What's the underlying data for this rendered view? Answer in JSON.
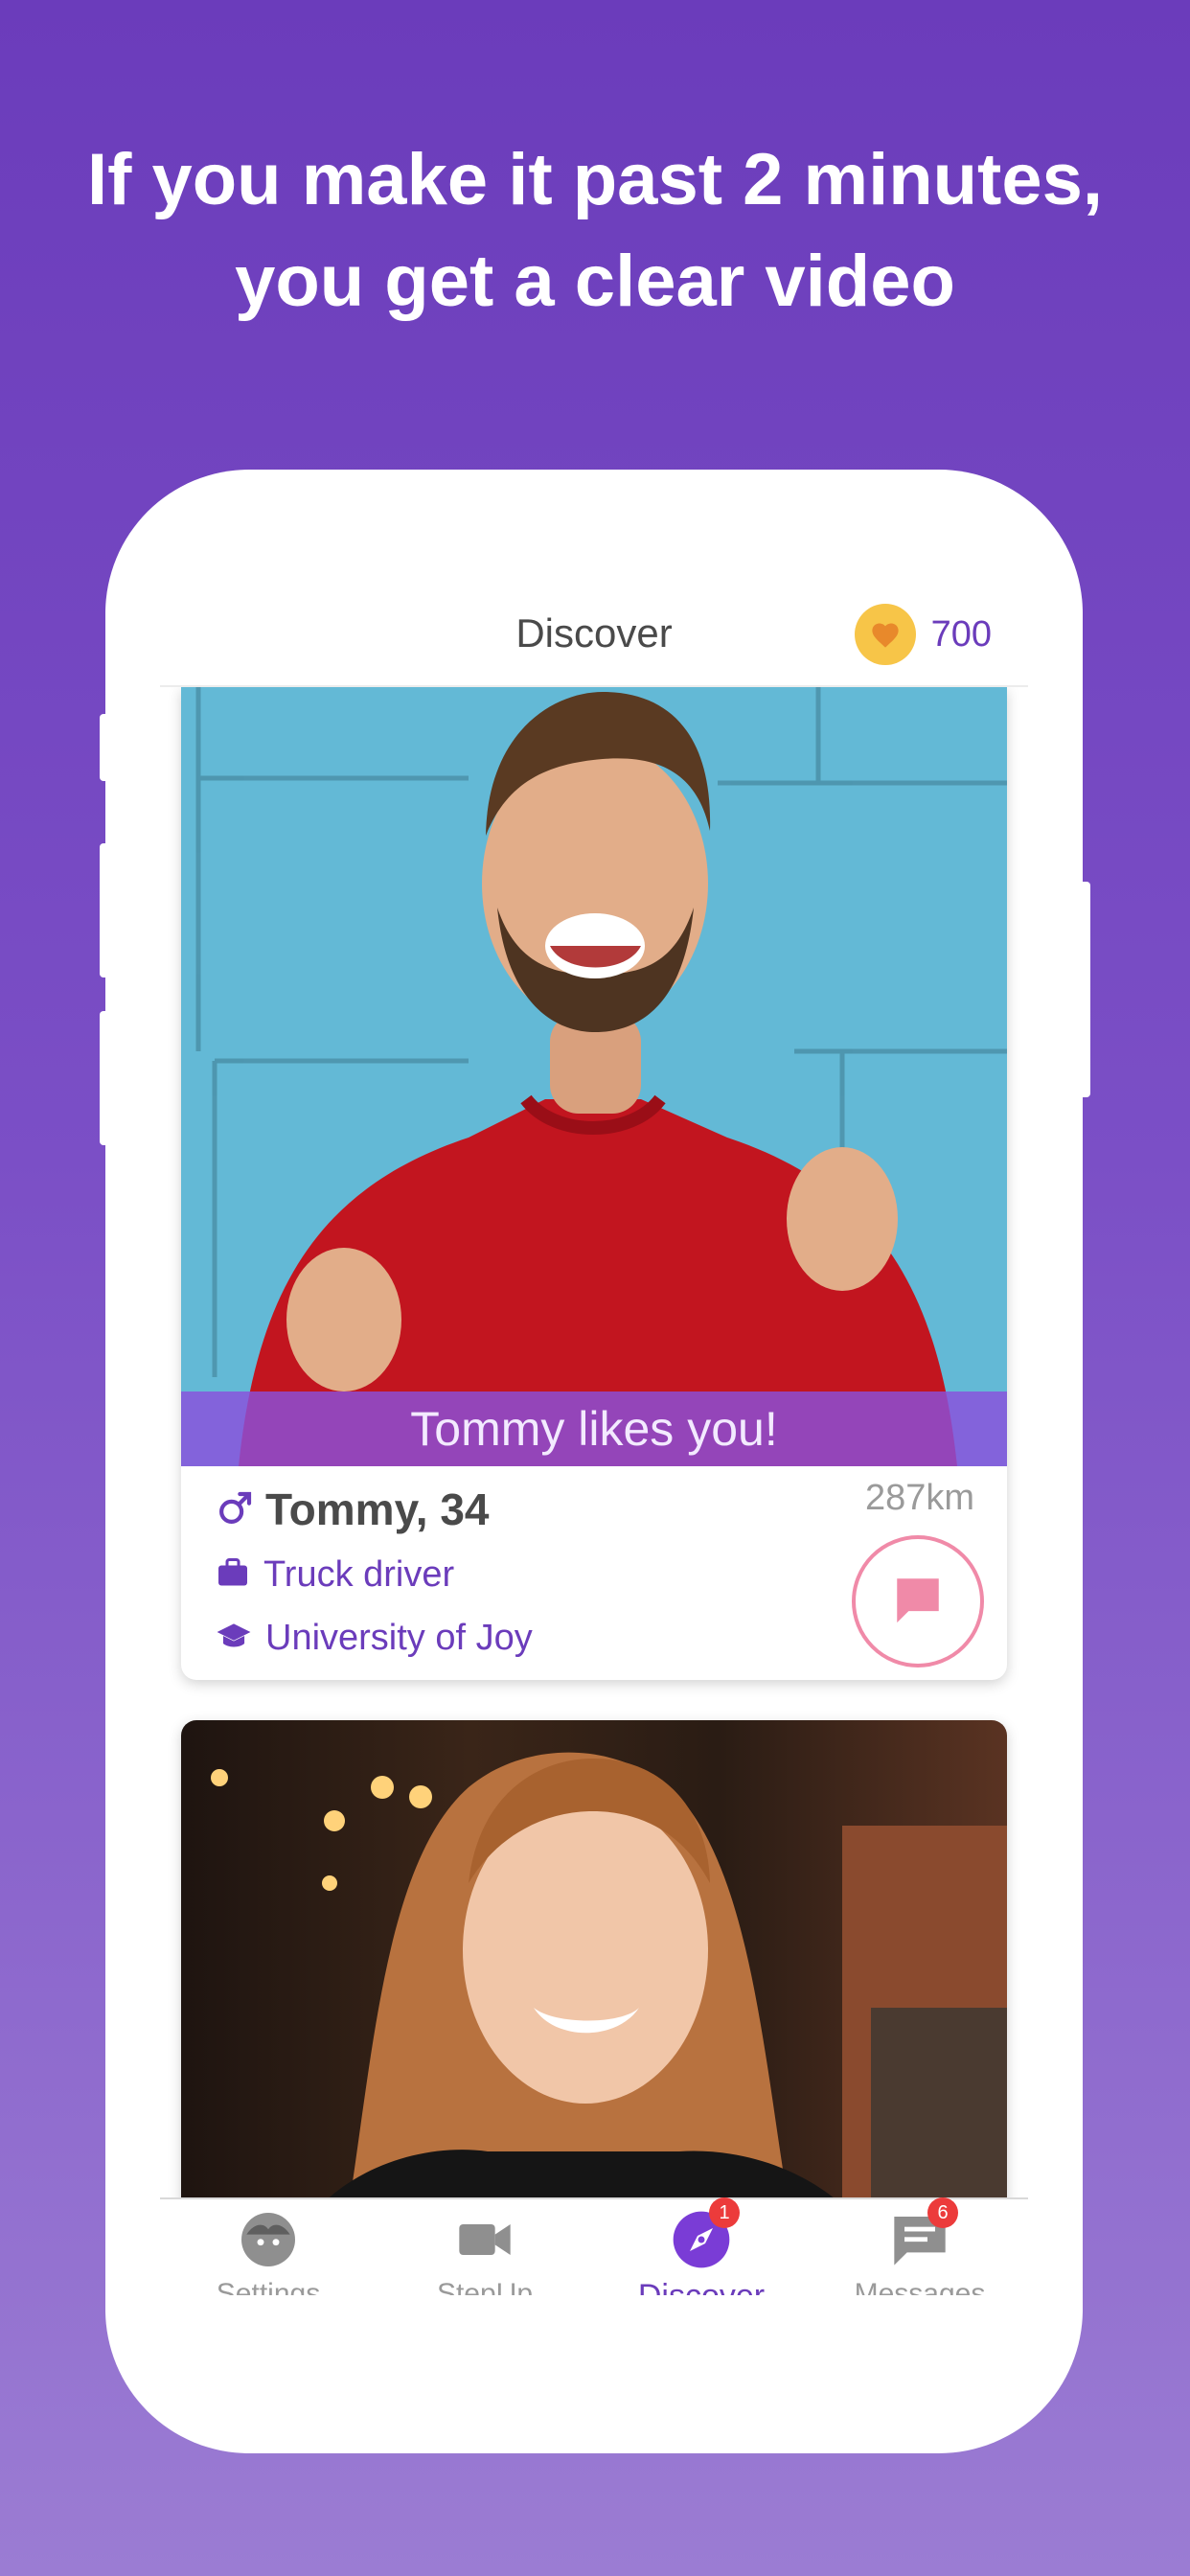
{
  "headline": {
    "line1": "If you make it past 2 minutes,",
    "line2": "you get a clear video"
  },
  "topbar": {
    "title": "Discover",
    "coins": "700",
    "coin_icon": "heart-coin-icon"
  },
  "cards": [
    {
      "banner": "Tommy likes you!",
      "name": "Tommy, 34",
      "gender_icon": "male-icon",
      "job": "Truck driver",
      "school": "University of Joy",
      "distance": "287km",
      "action_icon": "chat-bubble-icon"
    }
  ],
  "tabbar": {
    "tabs": [
      {
        "label": "Settings",
        "icon": "face-icon",
        "active": false
      },
      {
        "label": "StepUp",
        "icon": "video-camera-icon",
        "active": false
      },
      {
        "label": "Discover",
        "icon": "compass-icon",
        "active": true,
        "badge": "1"
      },
      {
        "label": "Messages",
        "icon": "message-icon",
        "active": false,
        "badge": "6"
      }
    ]
  },
  "colors": {
    "brand": "#6b3cbb",
    "banner": "#8a50dc",
    "chat_accent": "#f08aa8",
    "coin": "#f7c548",
    "badge": "#ec3b3b"
  }
}
